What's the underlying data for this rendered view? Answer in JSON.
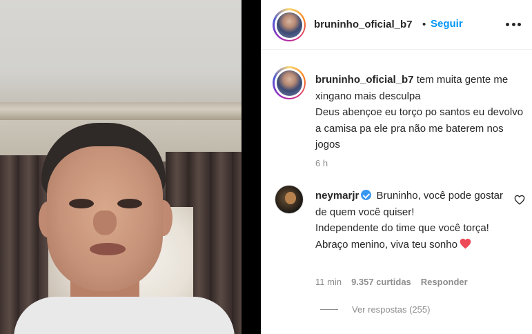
{
  "post": {
    "username": "bruninho_oficial_b7",
    "separator": "•",
    "follow_label": "Seguir"
  },
  "caption": {
    "username": "bruninho_oficial_b7",
    "line1": "tem muita gente me xingano mais desculpa",
    "line2": "Deus abençoe eu torço po santos eu devolvo a camisa pa ele pra não me baterem nos jogos",
    "time": "6 h"
  },
  "comment": {
    "username": "neymarjr",
    "text1": "Bruninho, você pode gostar de quem você quiser!",
    "text2": "Independente do time que você torça!",
    "text3": "Abraço menino, viva teu sonho",
    "time": "11 min",
    "likes": "9.357 curtidas",
    "reply_label": "Responder",
    "view_replies": "Ver respostas (255)"
  },
  "icons": {
    "more": "more-options-icon",
    "verified": "verified-badge-icon",
    "heart_emoji": "red-heart-icon",
    "like": "heart-outline-icon"
  },
  "colors": {
    "link_blue": "#0095f6",
    "muted": "#8e8e8e",
    "text": "#262626",
    "verified": "#3897f0",
    "heart": "#ed4956"
  }
}
